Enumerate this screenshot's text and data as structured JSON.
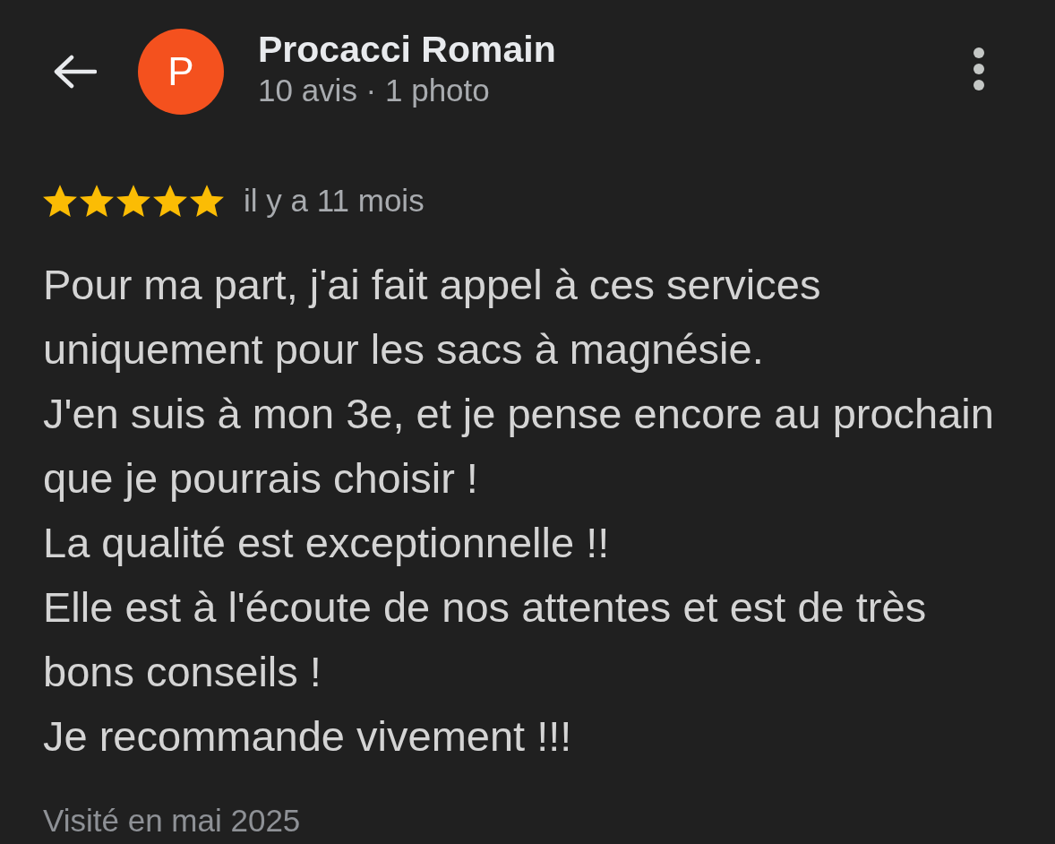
{
  "header": {
    "avatar_letter": "P",
    "name": "Procacci Romain",
    "subtitle": "10 avis · 1 photo"
  },
  "review": {
    "stars": 5,
    "time": "il y a 11 mois",
    "text": "Pour ma part, j'ai fait appel à ces services uniquement pour les sacs à magnésie.\nJ'en suis à mon 3e, et je pense encore au prochain que je pourrais choisir !\nLa qualité est exceptionnelle !!\nElle est à l'écoute de nos attentes et est de très bons conseils !\nJe recommande vivement !!!",
    "visited": "Visité en mai 2025"
  }
}
